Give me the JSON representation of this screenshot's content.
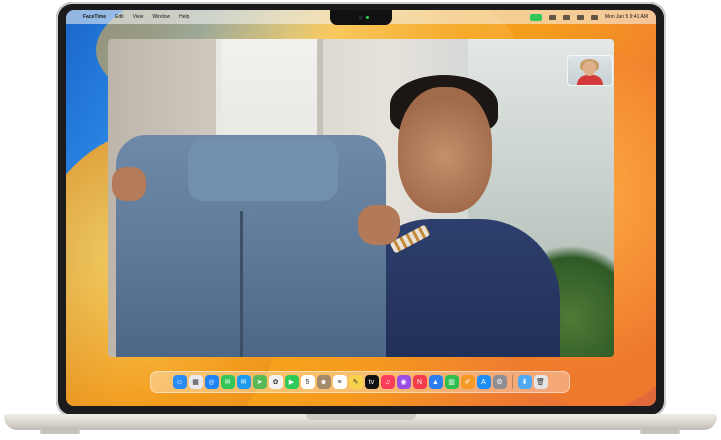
{
  "menubar": {
    "apple_icon": "apple-icon",
    "app_name": "FaceTime",
    "menus": [
      "Edit",
      "View",
      "Window",
      "Help"
    ],
    "status_icons": [
      "facetime-video-icon",
      "wifi-icon",
      "search-icon",
      "control-center-icon",
      "siri-icon"
    ],
    "clock": "Mon Jun 5  9:41 AM"
  },
  "facetime": {
    "window": "main-call-video",
    "self_view": "picture-in-picture"
  },
  "dock": {
    "apps": [
      {
        "name": "finder-icon",
        "glyph": "☺",
        "color": "#2a8cf0"
      },
      {
        "name": "launchpad-icon",
        "glyph": "▦",
        "color": "#e7e9ee"
      },
      {
        "name": "safari-icon",
        "glyph": "◎",
        "color": "#1e84f3"
      },
      {
        "name": "messages-icon",
        "glyph": "✉",
        "color": "#33c759"
      },
      {
        "name": "mail-icon",
        "glyph": "✉",
        "color": "#1d9bf0"
      },
      {
        "name": "maps-icon",
        "glyph": "➤",
        "color": "#58b957"
      },
      {
        "name": "photos-icon",
        "glyph": "✿",
        "color": "#f2f2f2"
      },
      {
        "name": "facetime-icon",
        "glyph": "▶",
        "color": "#2fca57"
      },
      {
        "name": "calendar-icon",
        "glyph": "5",
        "color": "#ffffff"
      },
      {
        "name": "contacts-icon",
        "glyph": "☻",
        "color": "#a58a6a"
      },
      {
        "name": "reminders-icon",
        "glyph": "≡",
        "color": "#ffffff"
      },
      {
        "name": "notes-icon",
        "glyph": "✎",
        "color": "#f7d24a"
      },
      {
        "name": "tv-icon",
        "glyph": "tv",
        "color": "#111111"
      },
      {
        "name": "music-icon",
        "glyph": "♫",
        "color": "#fb3c5a"
      },
      {
        "name": "podcasts-icon",
        "glyph": "◉",
        "color": "#9b4ee6"
      },
      {
        "name": "news-icon",
        "glyph": "N",
        "color": "#f43c4a"
      },
      {
        "name": "keynote-icon",
        "glyph": "▲",
        "color": "#2f7ef0"
      },
      {
        "name": "numbers-icon",
        "glyph": "▥",
        "color": "#2fbf4f"
      },
      {
        "name": "pages-icon",
        "glyph": "✐",
        "color": "#f59a25"
      },
      {
        "name": "app-store-icon",
        "glyph": "A",
        "color": "#1e8ef5"
      },
      {
        "name": "system-settings-icon",
        "glyph": "⚙",
        "color": "#8e8e93"
      }
    ],
    "trailing": [
      {
        "name": "downloads-folder-icon",
        "glyph": "⬇",
        "color": "#4fa9f5"
      },
      {
        "name": "trash-icon",
        "glyph": "🗑",
        "color": "#e4e4e6"
      }
    ]
  }
}
